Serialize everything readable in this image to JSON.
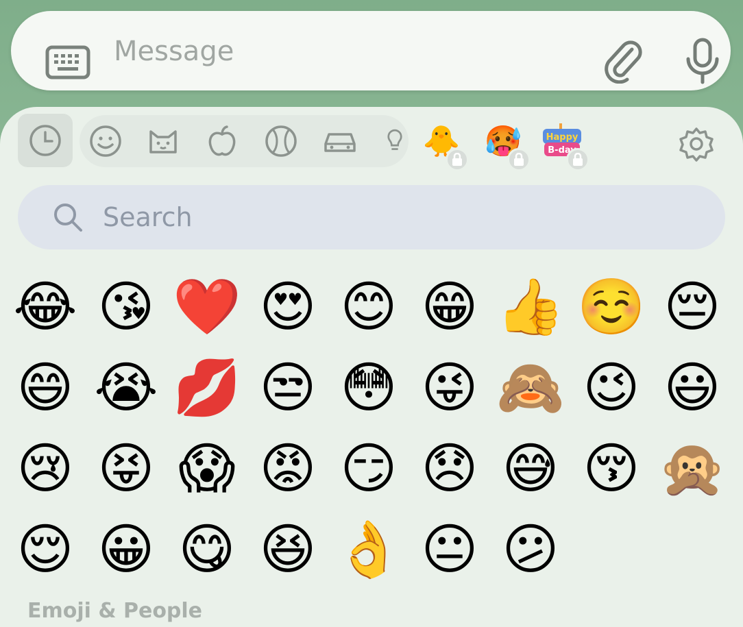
{
  "composer": {
    "placeholder": "Message",
    "keyboard_icon": "keyboard-icon",
    "attach_icon": "paperclip-icon",
    "mic_icon": "microphone-icon"
  },
  "emoji_panel": {
    "tabs": [
      {
        "name": "recent",
        "icon": "clock-icon",
        "active": true
      },
      {
        "name": "smileys",
        "icon": "smiley-icon"
      },
      {
        "name": "animals",
        "icon": "cat-icon"
      },
      {
        "name": "food",
        "icon": "apple-icon"
      },
      {
        "name": "activity",
        "icon": "ball-icon"
      },
      {
        "name": "travel",
        "icon": "car-icon"
      },
      {
        "name": "objects",
        "icon": "lightbulb-icon"
      }
    ],
    "packs": [
      {
        "art": "🐥",
        "locked": true
      },
      {
        "art": "🥵",
        "locked": true
      },
      {
        "art": "Happy B-day",
        "locked": true
      }
    ],
    "settings_icon": "gear-icon",
    "search": {
      "placeholder": "Search",
      "icon": "search-icon"
    },
    "emojis": [
      "😂",
      "😘",
      "❤️",
      "😍",
      "😊",
      "😁",
      "👍",
      "☺️",
      "😔",
      "😄",
      "😭",
      "💋",
      "😒",
      "😳",
      "😜",
      "🙈",
      "😉",
      "😃",
      "😢",
      "😝",
      "😱",
      "😡",
      "😏",
      "😞",
      "😅",
      "😚",
      "🙊",
      "😌",
      "😀",
      "😋",
      "😆",
      "👌",
      "😐",
      "😕"
    ],
    "section_title": "Emoji & People"
  }
}
